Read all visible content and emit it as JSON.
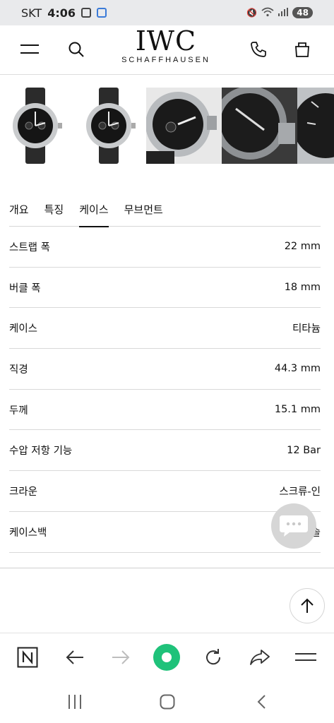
{
  "status_bar": {
    "carrier": "SKT",
    "time": "4:06",
    "battery": "48"
  },
  "header": {
    "brand": "IWC",
    "brand_sub": "SCHAFFHAUSEN"
  },
  "gallery": {
    "images": [
      "watch-front",
      "watch-front",
      "watch-detail-left",
      "watch-detail-dial",
      "watch-detail-right"
    ]
  },
  "tabs": [
    {
      "label": "개요"
    },
    {
      "label": "특징"
    },
    {
      "label": "케이스",
      "active": true
    },
    {
      "label": "무브먼트"
    }
  ],
  "specs": [
    {
      "label": "스트랩 폭",
      "value": "22 mm"
    },
    {
      "label": "버클 폭",
      "value": "18 mm"
    },
    {
      "label": "케이스",
      "value": "티타늄"
    },
    {
      "label": "직경",
      "value": "44.3 mm"
    },
    {
      "label": "두께",
      "value": "15.1 mm"
    },
    {
      "label": "수압 저항 기능",
      "value": "12 Bar"
    },
    {
      "label": "크라운",
      "value": "스크류-인"
    },
    {
      "label": "케이스백",
      "value": "솔"
    }
  ],
  "colors": {
    "accent_green": "#1fc27a",
    "text": "#111111",
    "divider": "#d9d9d9"
  }
}
